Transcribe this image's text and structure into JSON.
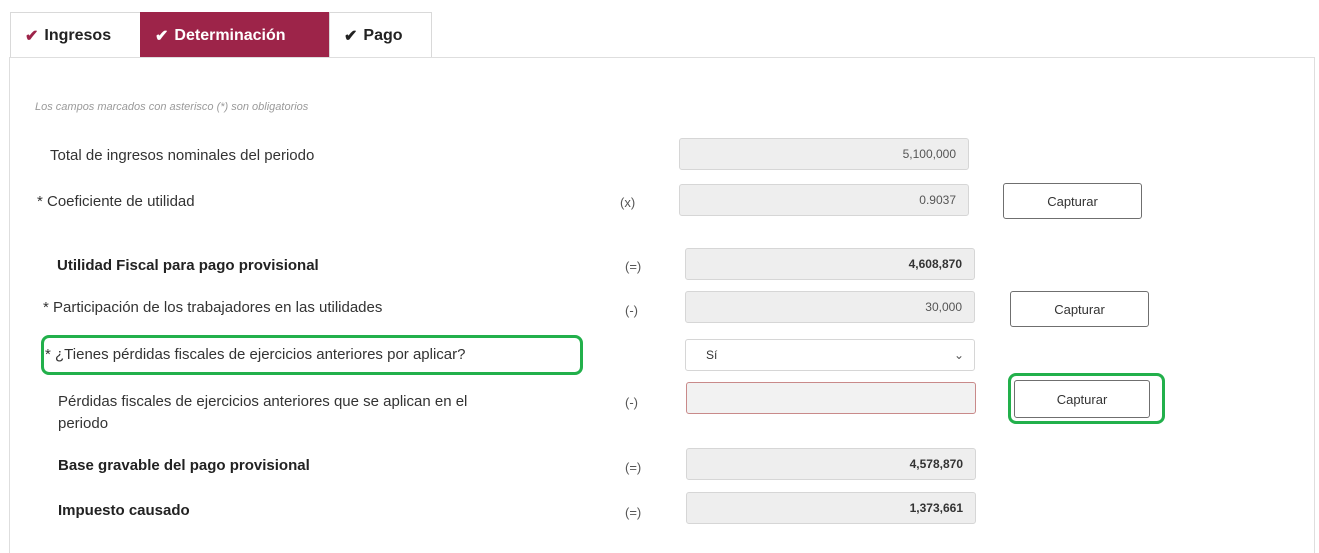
{
  "tabs": [
    {
      "label": "Ingresos",
      "icon": "check-icon"
    },
    {
      "label": "Determinación",
      "icon": "check-icon"
    },
    {
      "label": "Pago",
      "icon": "check-icon"
    }
  ],
  "active_tab": "Determinación",
  "colors": {
    "accent": "#9d2449",
    "highlight": "#22b04b",
    "error_border": "#c98a8a"
  },
  "form": {
    "note": "Los campos marcados con asterisco (*) son obligatorios",
    "rows": {
      "total_ingresos": {
        "label": "Total de ingresos nominales del periodo",
        "value": "5,100,000"
      },
      "coeficiente": {
        "label": "* Coeficiente de utilidad",
        "symbol": "(x)",
        "value": "0.9037",
        "button": "Capturar"
      },
      "utilidad_fiscal": {
        "label": "Utilidad Fiscal para pago provisional",
        "symbol": "(=)",
        "value": "4,608,870"
      },
      "ptu": {
        "label": "* Participación de los trabajadores en las utilidades",
        "symbol": "(-)",
        "value": "30,000",
        "button": "Capturar"
      },
      "perdidas_pregunta": {
        "label": "* ¿Tienes pérdidas fiscales de ejercicios anteriores por aplicar?",
        "selected": "Sí"
      },
      "perdidas_aplicadas": {
        "label_line1": "Pérdidas fiscales de ejercicios anteriores que se aplican en el",
        "label_line2": "periodo",
        "symbol": "(-)",
        "value": "",
        "button": "Capturar"
      },
      "base_gravable": {
        "label": "Base gravable del pago provisional",
        "symbol": "(=)",
        "value": "4,578,870"
      },
      "impuesto": {
        "label": "Impuesto causado",
        "symbol": "(=)",
        "value": "1,373,661"
      }
    }
  }
}
